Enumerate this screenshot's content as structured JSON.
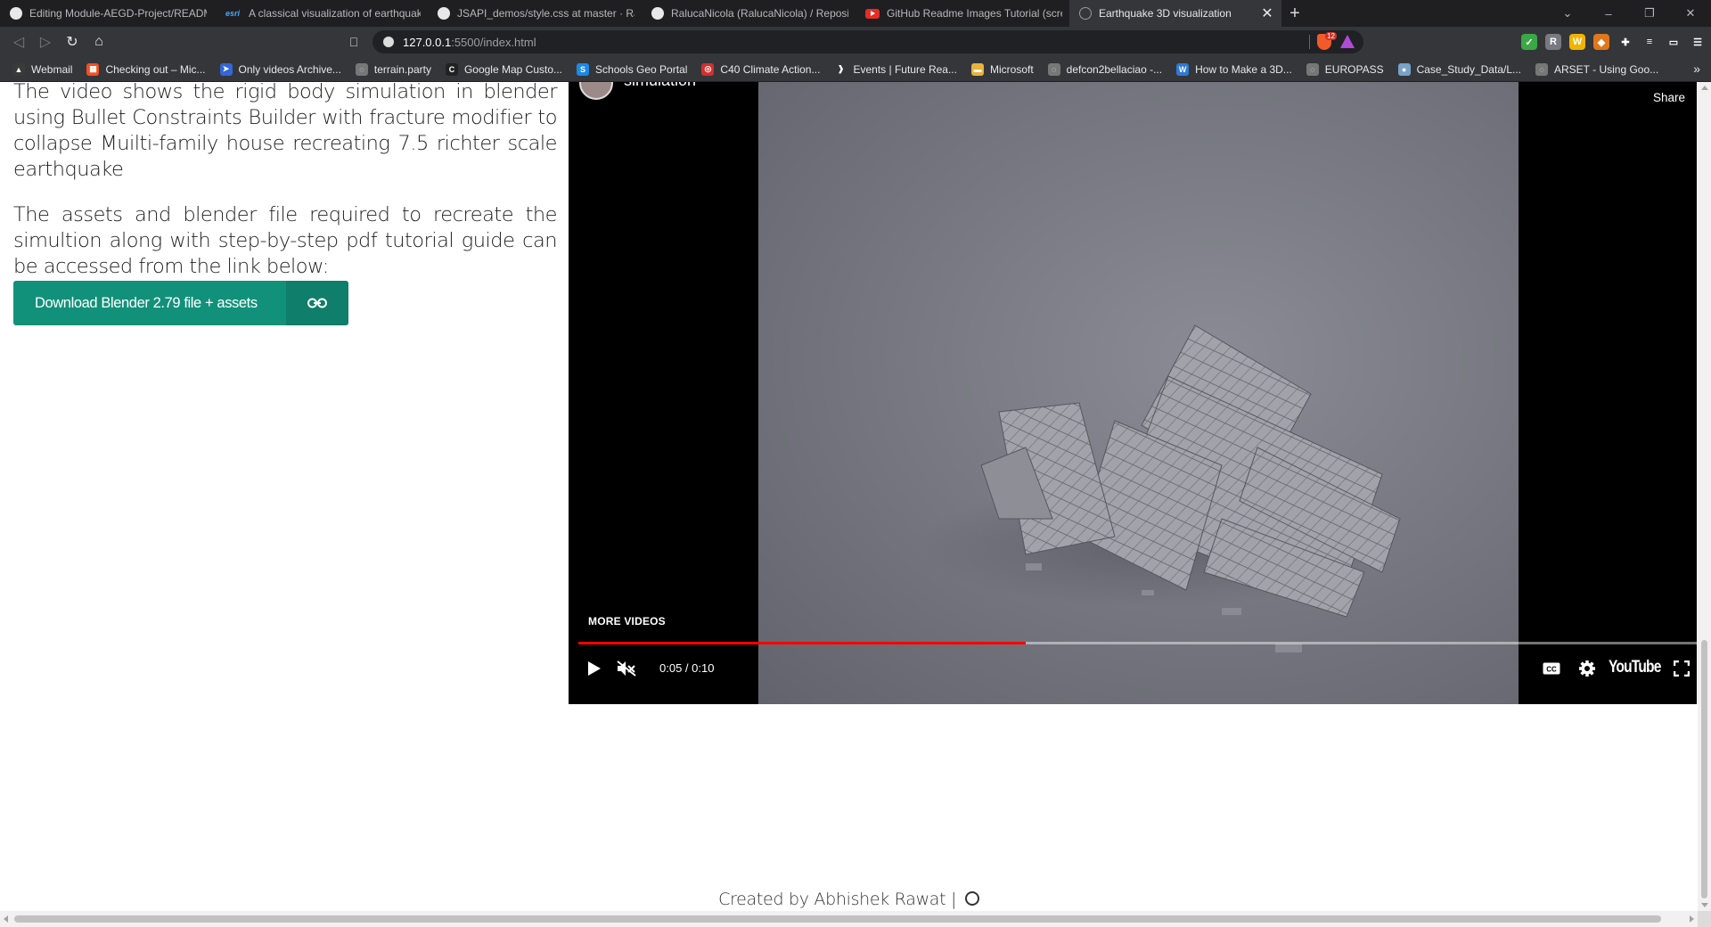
{
  "browser": {
    "tabs": [
      {
        "title": "Editing Module-AEGD-Project/READM",
        "icon": "github-icon",
        "active": false
      },
      {
        "title": "A classical visualization of earthquake",
        "icon": "esri-icon",
        "active": false
      },
      {
        "title": "JSAPI_demos/style.css at master · Ralu",
        "icon": "github-icon",
        "active": false
      },
      {
        "title": "RalucaNicola (RalucaNicola) / Reposito",
        "icon": "github-icon",
        "active": false
      },
      {
        "title": "GitHub Readme Images Tutorial (scree",
        "icon": "youtube-icon",
        "active": false
      },
      {
        "title": "Earthquake 3D visualization",
        "icon": "globe-icon",
        "active": true
      }
    ],
    "favicon_esri_text": "esri",
    "close_glyph": "✕",
    "newtab_glyph": "+",
    "window_controls": {
      "tab_search": "⌄",
      "minimize": "–",
      "restore": "❐",
      "close": "✕"
    },
    "nav": {
      "back": "◁",
      "forward": "▷",
      "reload": "↻",
      "home": "⌂",
      "bookmark": "⎕"
    },
    "url": {
      "host": "127.0.0.1",
      "path": ":5500/index.html"
    },
    "brave_badge_count": "12",
    "extensions": [
      {
        "name": "green-check-extension",
        "color": "#3aa845",
        "glyph": "✓"
      },
      {
        "name": "r-extension",
        "color": "#777a80",
        "glyph": "R"
      },
      {
        "name": "w-extension",
        "color": "#f0b400",
        "glyph": "W"
      },
      {
        "name": "fox-extension",
        "color": "#e2761b",
        "glyph": "◆"
      },
      {
        "name": "puzzle-extension",
        "color": "#35363a",
        "glyph": "✚"
      },
      {
        "name": "playlist-extension",
        "color": "#35363a",
        "glyph": "≡"
      },
      {
        "name": "wallet-extension",
        "color": "#35363a",
        "glyph": "▭"
      },
      {
        "name": "menu-extension",
        "color": "#35363a",
        "glyph": "☰"
      }
    ],
    "bookmarks": [
      {
        "label": "Webmail",
        "icon": "webmail-icon",
        "color": "#3a3a3a",
        "glyph": "▲"
      },
      {
        "label": "Checking out – Mic...",
        "icon": "microsoft-icon",
        "color": "#f25022",
        "glyph": "▦"
      },
      {
        "label": "Only videos Archive...",
        "icon": "arrow-icon",
        "color": "#3367d6",
        "glyph": "➤"
      },
      {
        "label": "terrain.party",
        "icon": "globe-icon",
        "color": "#777",
        "glyph": "◌"
      },
      {
        "label": "Google Map Custo...",
        "icon": "c-icon",
        "color": "#222",
        "glyph": "C"
      },
      {
        "label": "Schools Geo Portal",
        "icon": "portal-icon",
        "color": "#1e88e5",
        "glyph": "S"
      },
      {
        "label": "C40 Climate Action...",
        "icon": "c40-icon",
        "color": "#d32f2f",
        "glyph": "◎"
      },
      {
        "label": "Events | Future Rea...",
        "icon": "chevron-icon",
        "color": "#35363a",
        "glyph": "❱"
      },
      {
        "label": "Microsoft",
        "icon": "folder-icon",
        "color": "#e8b33d",
        "glyph": "▬"
      },
      {
        "label": "defcon2bellaciao -...",
        "icon": "globe-icon",
        "color": "#777",
        "glyph": "◌"
      },
      {
        "label": "How to Make a 3D...",
        "icon": "wordpress-icon",
        "color": "#2d7ad6",
        "glyph": "W"
      },
      {
        "label": "EUROPASS",
        "icon": "globe-icon",
        "color": "#777",
        "glyph": "◌"
      },
      {
        "label": "Case_Study_Data/L...",
        "icon": "github-icon",
        "color": "#7aa2c8",
        "glyph": "●"
      },
      {
        "label": "ARSET - Using Goo...",
        "icon": "globe-icon",
        "color": "#777",
        "glyph": "◌"
      }
    ],
    "bookmarks_more": "»"
  },
  "page": {
    "description_1": "The video shows the rigid body simulation in blender using Bullet Constraints Builder with fracture modifier to collapse Muilti-family house recreating 7.5 richter scale earthquake",
    "description_2": "The assets and blender file required to recreate the simultion along with step-by-step pdf tutorial guide can be accessed from the link below:",
    "download_button": "Download Blender 2.79 file + assets",
    "footer": "Created by Abhishek Rawat |"
  },
  "video": {
    "title": "simulation",
    "share_label": "Share",
    "more_videos": "MORE VIDEOS",
    "time": "0:05 / 0:10",
    "progress": 0.4,
    "logo": "YouTube",
    "progress_color": "#ff0000"
  }
}
